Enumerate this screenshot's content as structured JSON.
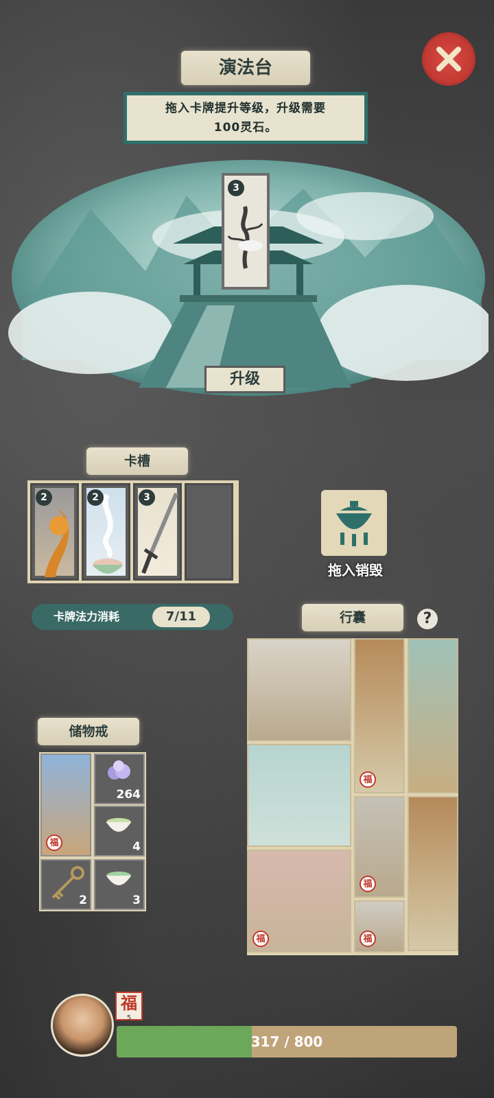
{
  "header": {
    "title": "演法台",
    "close_icon": "close-x-icon"
  },
  "instructions": {
    "line1": "拖入卡牌提升等级，升级需要",
    "line2": "100灵石。"
  },
  "upgrade_card": {
    "level": "3",
    "art": "tree-card-art"
  },
  "upgrade_button": {
    "label": "升级"
  },
  "card_slot": {
    "title": "卡槽",
    "cards": [
      {
        "level": "2",
        "art": "fire-card-art"
      },
      {
        "level": "2",
        "art": "steaming-bowl-card-art"
      },
      {
        "level": "3",
        "art": "sword-card-art"
      },
      {
        "level": "",
        "art": "empty-slot"
      }
    ]
  },
  "destroy": {
    "icon": "censer-icon",
    "label": "拖入销毁"
  },
  "mana": {
    "label": "卡牌法力消耗",
    "value": "7/11"
  },
  "bag": {
    "title": "行囊",
    "help_icon": "question-icon",
    "help_text": "?"
  },
  "storage": {
    "title": "储物戒",
    "items": [
      {
        "art": "study-card-art",
        "count": "",
        "badge": "福"
      },
      {
        "art": "gem-icon",
        "count": "264"
      },
      {
        "art": "tea-bowl-icon",
        "count": "4"
      },
      {
        "art": "key-icon",
        "count": "2"
      },
      {
        "art": "green-tea-bowl-icon",
        "count": "3"
      }
    ]
  },
  "player": {
    "badge": "福",
    "badge_num": "5",
    "hp_text": "317 / 800",
    "hp_current": 317,
    "hp_max": 800
  },
  "colors": {
    "accent": "#2f6f6b",
    "paper": "#e0d4b2",
    "hp": "#6ba85a",
    "close": "#c23a33"
  }
}
